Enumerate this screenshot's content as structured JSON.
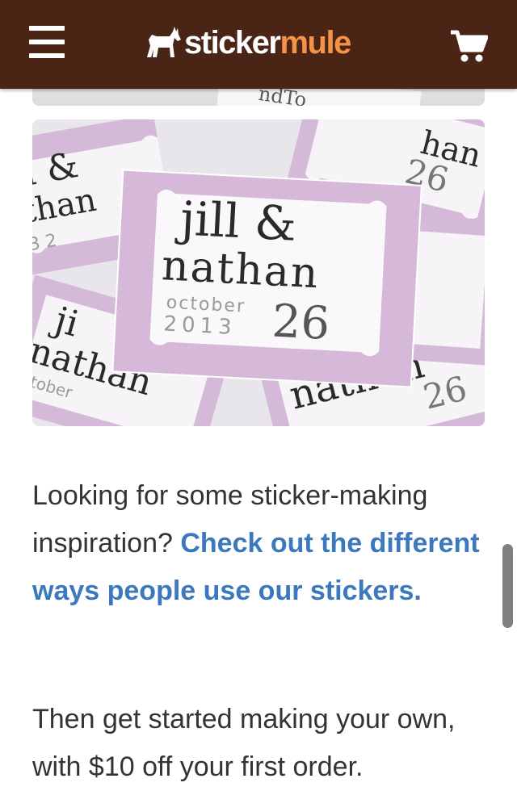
{
  "header": {
    "menu_icon": "hamburger-menu-icon",
    "brand": {
      "part1": "sticker",
      "part2": "mule",
      "mascot_icon": "mule-icon"
    },
    "cart_icon": "shopping-cart-icon"
  },
  "images": {
    "previous": {
      "visible_text": "ndTo"
    },
    "main": {
      "center_names_line1": "jill &",
      "center_names_line2": "nathan",
      "center_month": "october",
      "center_year": "2013",
      "center_day": "26"
    }
  },
  "content": {
    "para1_text": "Looking for some sticker-making inspiration?",
    "para1_link": "Check out the different ways people use our stickers.",
    "para2_text": "Then get started making your own, with $10 off your first order."
  },
  "colors": {
    "header_bg": "#4a2415",
    "brand_accent": "#f3934a",
    "link": "#3c78bd",
    "sticker_pink": "#d2b7d6"
  }
}
